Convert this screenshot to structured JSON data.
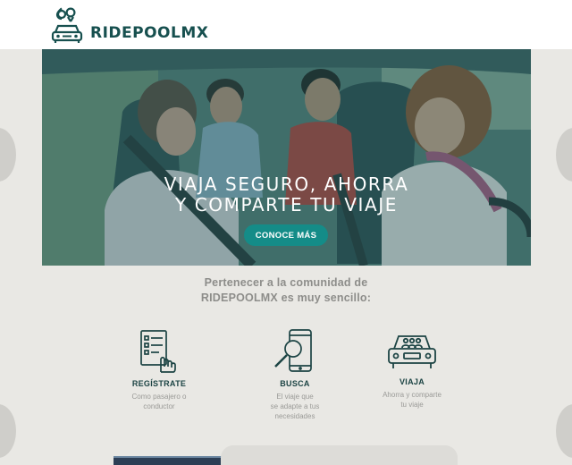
{
  "brand": {
    "name": "RIDEPOOLMX",
    "logo_icon": "car-location-pins-logo",
    "color": "#17504f"
  },
  "hero": {
    "title_line1": "VIAJA SEGURO, AHORRA",
    "title_line2": "Y COMPARTE TU VIAJE",
    "cta_label": "CONOCE MÁS",
    "cta_color": "#148c88",
    "image": "friends-in-car-photo"
  },
  "intro": {
    "line1": "Pertenecer a la comunidad de",
    "line2": "RIDEPOOLMX es muy sencillo:"
  },
  "steps": [
    {
      "icon": "checklist-hand-icon",
      "title": "REGÍSTRATE",
      "desc_line1": "Como pasajero o",
      "desc_line2": "conductor",
      "desc_line3": ""
    },
    {
      "icon": "phone-search-icon",
      "title": "BUSCA",
      "desc_line1": "El viaje que",
      "desc_line2": "se adapte a tus",
      "desc_line3": "necesidades"
    },
    {
      "icon": "car-passengers-icon",
      "title": "VIAJA",
      "desc_line1": "Ahorra y comparte",
      "desc_line2": "tu viaje",
      "desc_line3": ""
    }
  ]
}
